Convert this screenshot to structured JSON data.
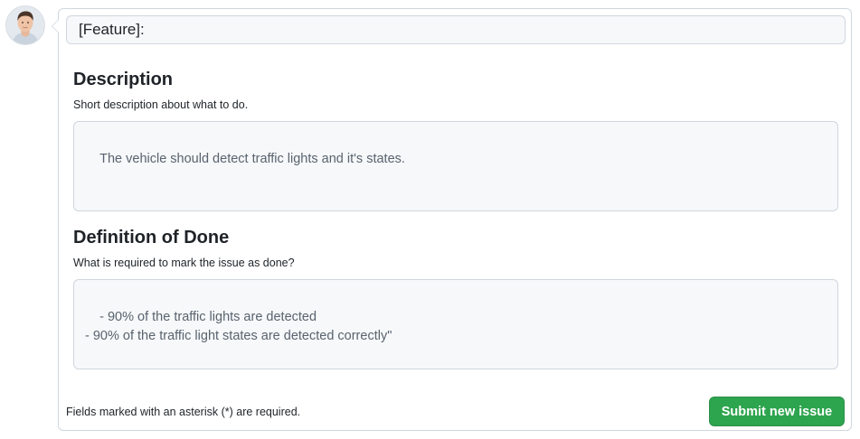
{
  "issue_title": {
    "value": "[Feature]:"
  },
  "sections": [
    {
      "heading": "Description",
      "hint": "Short description about what to do.",
      "value": "The vehicle should detect traffic lights and it's states."
    },
    {
      "heading": "Definition of Done",
      "hint": "What is required to mark the issue as done?",
      "value": "- 90% of the traffic lights are detected\n- 90% of the traffic light states are detected correctly\""
    }
  ],
  "footer": {
    "note": "Fields marked with an asterisk (*) are required.",
    "submit_label": "Submit new issue"
  },
  "colors": {
    "primary_button": "#2da44e",
    "field_background": "#f6f8fa",
    "border": "#d0d7de"
  },
  "icons": {
    "avatar": "user-avatar",
    "resize": "resize-grip-icon"
  }
}
